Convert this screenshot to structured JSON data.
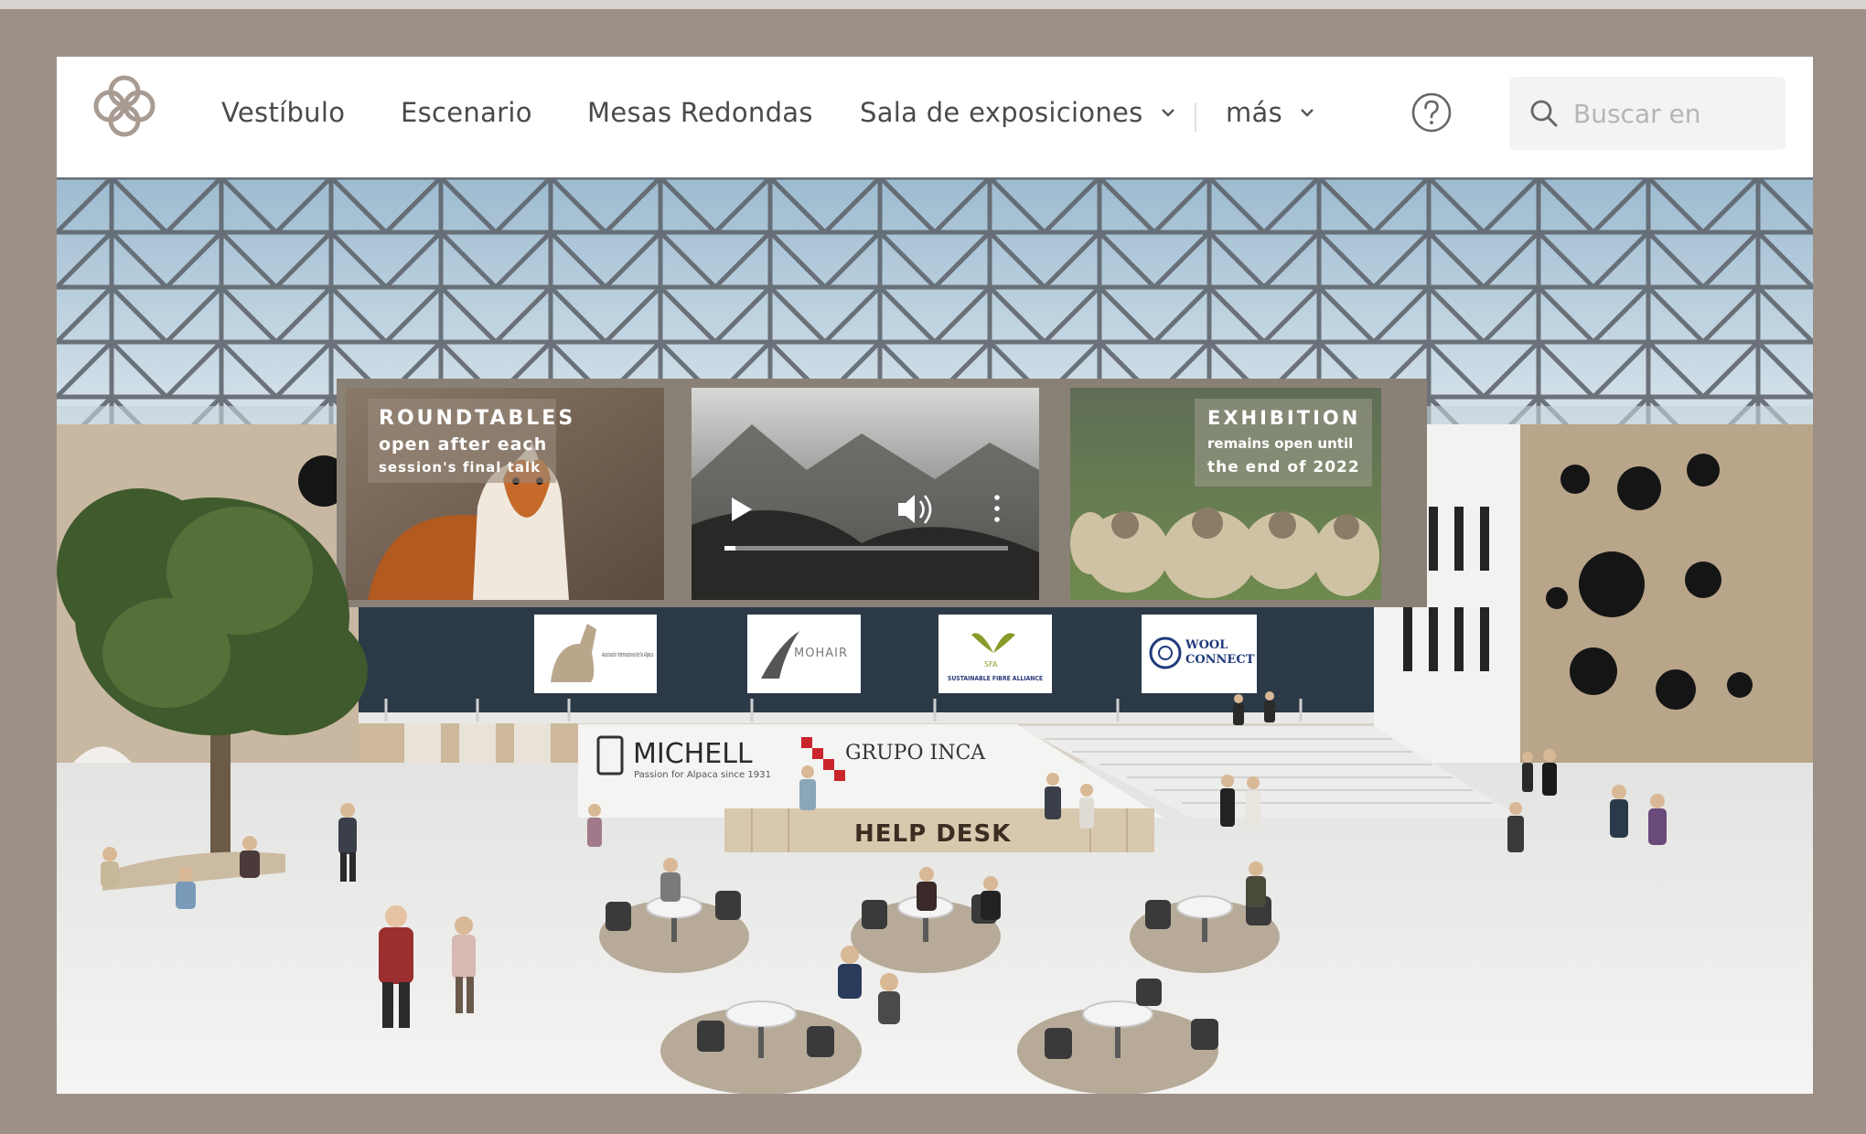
{
  "nav": {
    "items": [
      {
        "label": "Vestíbulo"
      },
      {
        "label": "Escenario"
      },
      {
        "label": "Mesas Redondas"
      },
      {
        "label": "Sala de exposiciones"
      },
      {
        "label": "más"
      }
    ],
    "search_placeholder": "Buscar en"
  },
  "screens": {
    "roundtables": {
      "title": "ROUNDTABLES",
      "line1": "open after each",
      "line2": "session's final talk"
    },
    "exhibition": {
      "title": "EXHIBITION",
      "line1": "remains open until",
      "line2": "the end of 2022"
    },
    "video": {
      "progress": 0.04
    }
  },
  "sponsors": {
    "aia": "Asociación Internacional de la Alpaca",
    "mohair": "MOHAIR",
    "sfa_short": "SFA",
    "sfa": "SUSTAINABLE FIBRE ALLIANCE",
    "wool1": "WOOL",
    "wool2": "CONNECT"
  },
  "desk": {
    "michell": "MICHELL",
    "michell_tag": "Passion for Alpaca since 1931",
    "inca": "GRUPO INCA",
    "help": "HELP DESK"
  },
  "colors": {
    "frame": "#9d9086",
    "nav_text": "#4a4a4a",
    "accent": "#8a6a50"
  }
}
